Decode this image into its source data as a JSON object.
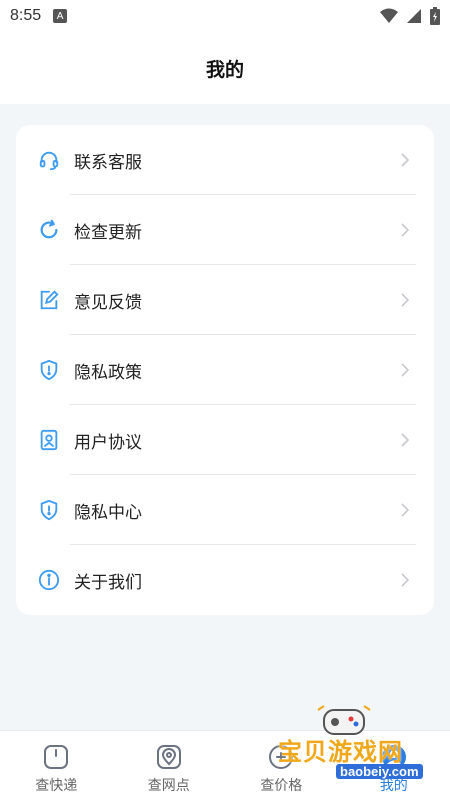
{
  "status": {
    "time": "8:55",
    "notification_badge": "A"
  },
  "header": {
    "title": "我的"
  },
  "menu": [
    {
      "id": "contact",
      "label": "联系客服",
      "icon": "headset-icon"
    },
    {
      "id": "update",
      "label": "检查更新",
      "icon": "refresh-icon"
    },
    {
      "id": "feedback",
      "label": "意见反馈",
      "icon": "edit-note-icon"
    },
    {
      "id": "privacy-policy",
      "label": "隐私政策",
      "icon": "shield-icon"
    },
    {
      "id": "user-agreement",
      "label": "用户协议",
      "icon": "id-card-icon"
    },
    {
      "id": "privacy-center",
      "label": "隐私中心",
      "icon": "shield-icon"
    },
    {
      "id": "about",
      "label": "关于我们",
      "icon": "info-icon"
    }
  ],
  "tabs": [
    {
      "id": "express",
      "label": "查快递",
      "icon": "package-icon",
      "active": false
    },
    {
      "id": "outlet",
      "label": "查网点",
      "icon": "location-pin-icon",
      "active": false
    },
    {
      "id": "price",
      "label": "查价格",
      "icon": "price-icon",
      "active": false
    },
    {
      "id": "mine",
      "label": "我的",
      "icon": "user-icon",
      "active": true
    }
  ],
  "watermark": {
    "title": "宝贝游戏网",
    "site": "baobeiy.com"
  },
  "colors": {
    "accent": "#2a7de1",
    "icon_blue": "#3d9bf0",
    "watermark_orange": "#f0a81a"
  }
}
